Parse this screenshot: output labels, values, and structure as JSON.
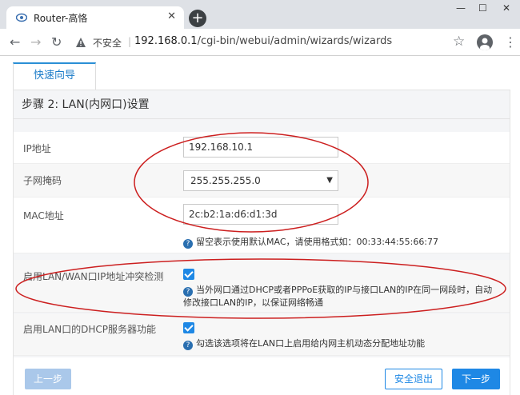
{
  "browser": {
    "tab_title": "Router-高恪",
    "tab_close": "✕",
    "new_tab": "+",
    "minimize": "—",
    "maximize": "☐",
    "close": "✕",
    "insecure_label": "不安全",
    "url_host": "192.168.0.1",
    "url_path": "/cgi-bin/webui/admin/wizards/wizards"
  },
  "wizard": {
    "tab_label": "快速向导",
    "step_title": "步骤 2: LAN(内网口)设置"
  },
  "form": {
    "ip_label": "IP地址",
    "ip_value": "192.168.10.1",
    "mask_label": "子网掩码",
    "mask_value": "255.255.255.0",
    "mac_label": "MAC地址",
    "mac_value": "2c:b2:1a:d6:d1:3d",
    "mac_hint": "留空表示使用默认MAC，请使用格式如：00:33:44:55:66:77",
    "conflict_label": "启用LAN/WAN口IP地址冲突检测",
    "conflict_checked": true,
    "conflict_hint_line1": "当外网口通过DHCP或者PPPoE获取的IP与接口LAN的IP在同一网段时，自动",
    "conflict_hint_line2": "修改接口LAN的IP，以保证网络畅通",
    "dhcp_label": "启用LAN口的DHCP服务器功能",
    "dhcp_checked": true,
    "dhcp_hint": "勾选该选项将在LAN口上启用给内网主机动态分配地址功能"
  },
  "buttons": {
    "prev": "上一步",
    "exit": "安全退出",
    "next": "下一步"
  },
  "colors": {
    "accent": "#1e88e5",
    "annotation": "#cc1f1f"
  }
}
